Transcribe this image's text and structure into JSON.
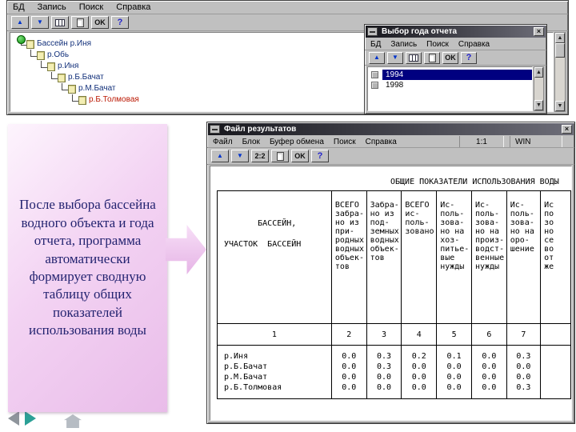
{
  "colors": {
    "selection": "#000080",
    "titlebar_dark": "#17171d",
    "titlebar_light": "#6d6d78",
    "tree_selected": "#bb1803",
    "callout_pink": "#e9bce9",
    "nav_next": "#2ba096",
    "nav_prev": "#8f959c"
  },
  "glyphs": {
    "up": "▲",
    "down": "▼",
    "ok": "OK",
    "help": "?",
    "close": "×",
    "pager": "2:2"
  },
  "main_window": {
    "menu": [
      "БД",
      "Запись",
      "Поиск",
      "Справка"
    ],
    "tree": {
      "items": [
        {
          "label": "Бассейн р.Иня",
          "selected": false
        },
        {
          "label": "р.Обь",
          "selected": false
        },
        {
          "label": "р.Иня",
          "selected": false
        },
        {
          "label": "р.Б.Бачат",
          "selected": false
        },
        {
          "label": "р.М.Бачат",
          "selected": false
        },
        {
          "label": "р.Б.Толмовая",
          "selected": true
        }
      ]
    }
  },
  "year_window": {
    "title": "Выбор года отчета",
    "menu": [
      "БД",
      "Запись",
      "Поиск",
      "Справка"
    ],
    "years": [
      {
        "label": "1994",
        "selected": true
      },
      {
        "label": "1998",
        "selected": false
      }
    ]
  },
  "results_window": {
    "title": "Файл результатов",
    "menu": [
      "Файл",
      "Блок",
      "Буфер обмена",
      "Поиск",
      "Справка"
    ],
    "status": {
      "scale": "1:1",
      "mode": "WIN"
    },
    "heading": "ОБЩИЕ ПОКАЗАТЕЛИ ИСПОЛЬЗОВАНИЯ ВОДЫ",
    "table": {
      "corner_header": "       БАССЕЙН,\n\nУЧАСТОК  БАССЕЙН",
      "columns": [
        "ВСЕГО\nзабра-\nно из\nпри-\nродных\nводных\nобъек-\nтов",
        "Забра-\nно из\nпод-\nземных\nводных\nобъек-\nтов",
        "ВСЕГО\nис-\nполь-\nзовано",
        "Ис-\nполь-\nзова-\nно на\nхоз-\nпитье-\nвые\nнужды",
        "Ис-\nполь-\nзова-\nно на\nпроиз-\nводст-\nвенные\nнужды",
        "Ис-\nполь-\nзова-\nно на\nоро-\nшение",
        "Ис\nпо\nзо\nно\nсе\nво\nот\nже"
      ],
      "column_numbers": [
        "1",
        "2",
        "3",
        "4",
        "5",
        "6",
        "7",
        ""
      ],
      "rows": [
        {
          "name": "р.Иня",
          "values": [
            "0.0",
            "0.3",
            "0.2",
            "0.1",
            "0.0",
            "0.3",
            ""
          ]
        },
        {
          "name": "р.Б.Бачат",
          "values": [
            "0.0",
            "0.3",
            "0.0",
            "0.0",
            "0.0",
            "0.0",
            ""
          ]
        },
        {
          "name": "р.М.Бачат",
          "values": [
            "0.0",
            "0.0",
            "0.0",
            "0.0",
            "0.0",
            "0.0",
            ""
          ]
        },
        {
          "name": "р.Б.Толмовая",
          "values": [
            "0.0",
            "0.0",
            "0.0",
            "0.0",
            "0.0",
            "0.3",
            ""
          ]
        }
      ]
    }
  },
  "callout": {
    "text": "После выбора бассейна водного объекта и года отчета, программа автоматически формирует сводную таблицу общих показателей использования воды"
  }
}
